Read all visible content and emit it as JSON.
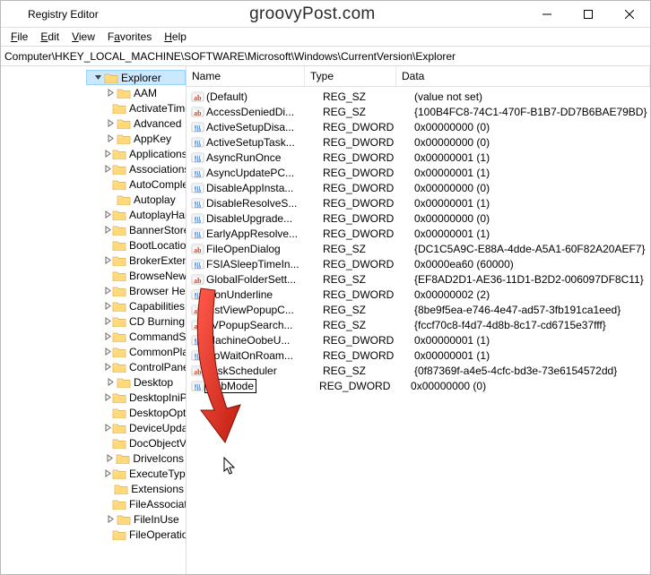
{
  "titlebar": {
    "title": "Registry Editor",
    "watermark": "groovyPost.com"
  },
  "menu": {
    "file": "File",
    "edit": "Edit",
    "view": "View",
    "favorites": "Favorites",
    "help": "Help"
  },
  "address": "Computer\\HKEY_LOCAL_MACHINE\\SOFTWARE\\Microsoft\\Windows\\CurrentVersion\\Explorer",
  "tree": {
    "root": "Explorer",
    "items": [
      {
        "label": "AAM",
        "exp": false
      },
      {
        "label": "ActivateTimer",
        "exp": false,
        "chev": false
      },
      {
        "label": "Advanced",
        "exp": false
      },
      {
        "label": "AppKey",
        "exp": false
      },
      {
        "label": "Applications",
        "exp": false
      },
      {
        "label": "Associations",
        "exp": false
      },
      {
        "label": "AutoComplete",
        "exp": false,
        "chev": false
      },
      {
        "label": "Autoplay",
        "exp": false,
        "chev": false
      },
      {
        "label": "AutoplayHandlers",
        "exp": false
      },
      {
        "label": "BannerStore",
        "exp": false
      },
      {
        "label": "BootLocations",
        "exp": false,
        "chev": false
      },
      {
        "label": "BrokerExtensions",
        "exp": false
      },
      {
        "label": "BrowseNewProcess",
        "exp": false,
        "chev": false
      },
      {
        "label": "Browser Helper Objects",
        "exp": false
      },
      {
        "label": "Capabilities",
        "exp": false
      },
      {
        "label": "CD Burning",
        "exp": false
      },
      {
        "label": "CommandStore",
        "exp": false
      },
      {
        "label": "CommonPlaces",
        "exp": false
      },
      {
        "label": "ControlPanel",
        "exp": false
      },
      {
        "label": "Desktop",
        "exp": false
      },
      {
        "label": "DesktopIniPropertyMap",
        "exp": false
      },
      {
        "label": "DesktopOptimization",
        "exp": false,
        "chev": false
      },
      {
        "label": "DeviceUpdate",
        "exp": false
      },
      {
        "label": "DocObjectView",
        "exp": false,
        "chev": false
      },
      {
        "label": "DriveIcons",
        "exp": false
      },
      {
        "label": "ExecuteTypeDelegation",
        "exp": false
      },
      {
        "label": "Extensions",
        "exp": false,
        "chev": false
      },
      {
        "label": "FileAssociation",
        "exp": false,
        "chev": false
      },
      {
        "label": "FileInUse",
        "exp": false
      },
      {
        "label": "FileOperations",
        "exp": false,
        "chev": false
      }
    ]
  },
  "columns": {
    "name": "Name",
    "type": "Type",
    "data": "Data"
  },
  "values": [
    {
      "icon": "sz",
      "name": "(Default)",
      "type": "REG_SZ",
      "data": "(value not set)"
    },
    {
      "icon": "sz",
      "name": "AccessDeniedDi...",
      "type": "REG_SZ",
      "data": "{100B4FC8-74C1-470F-B1B7-DD7B6BAE79BD}"
    },
    {
      "icon": "dw",
      "name": "ActiveSetupDisa...",
      "type": "REG_DWORD",
      "data": "0x00000000 (0)"
    },
    {
      "icon": "dw",
      "name": "ActiveSetupTask...",
      "type": "REG_DWORD",
      "data": "0x00000000 (0)"
    },
    {
      "icon": "dw",
      "name": "AsyncRunOnce",
      "type": "REG_DWORD",
      "data": "0x00000001 (1)"
    },
    {
      "icon": "dw",
      "name": "AsyncUpdatePC...",
      "type": "REG_DWORD",
      "data": "0x00000001 (1)"
    },
    {
      "icon": "dw",
      "name": "DisableAppInsta...",
      "type": "REG_DWORD",
      "data": "0x00000000 (0)"
    },
    {
      "icon": "dw",
      "name": "DisableResolveS...",
      "type": "REG_DWORD",
      "data": "0x00000001 (1)"
    },
    {
      "icon": "dw",
      "name": "DisableUpgrade...",
      "type": "REG_DWORD",
      "data": "0x00000000 (0)"
    },
    {
      "icon": "dw",
      "name": "EarlyAppResolve...",
      "type": "REG_DWORD",
      "data": "0x00000001 (1)"
    },
    {
      "icon": "sz",
      "name": "FileOpenDialog",
      "type": "REG_SZ",
      "data": "{DC1C5A9C-E88A-4dde-A5A1-60F82A20AEF7}"
    },
    {
      "icon": "dw",
      "name": "FSIASleepTimeIn...",
      "type": "REG_DWORD",
      "data": "0x0000ea60 (60000)"
    },
    {
      "icon": "sz",
      "name": "GlobalFolderSett...",
      "type": "REG_SZ",
      "data": "{EF8AD2D1-AE36-11D1-B2D2-006097DF8C11}"
    },
    {
      "icon": "dw",
      "name": "IconUnderline",
      "type": "REG_DWORD",
      "data": "0x00000002 (2)"
    },
    {
      "icon": "sz",
      "name": "ListViewPopupC...",
      "type": "REG_SZ",
      "data": "{8be9f5ea-e746-4e47-ad57-3fb191ca1eed}"
    },
    {
      "icon": "sz",
      "name": "LVPopupSearch...",
      "type": "REG_SZ",
      "data": "{fccf70c8-f4d7-4d8b-8c17-cd6715e37fff}"
    },
    {
      "icon": "dw",
      "name": "MachineOobeU...",
      "type": "REG_DWORD",
      "data": "0x00000001 (1)"
    },
    {
      "icon": "dw",
      "name": "NoWaitOnRoam...",
      "type": "REG_DWORD",
      "data": "0x00000001 (1)"
    },
    {
      "icon": "sz",
      "name": "TaskScheduler",
      "type": "REG_SZ",
      "data": "{0f87369f-a4e5-4cfc-bd3e-73e6154572dd}"
    },
    {
      "icon": "dw",
      "name": "HubMode",
      "type": "REG_DWORD",
      "data": "0x00000000 (0)",
      "editing": true
    }
  ]
}
